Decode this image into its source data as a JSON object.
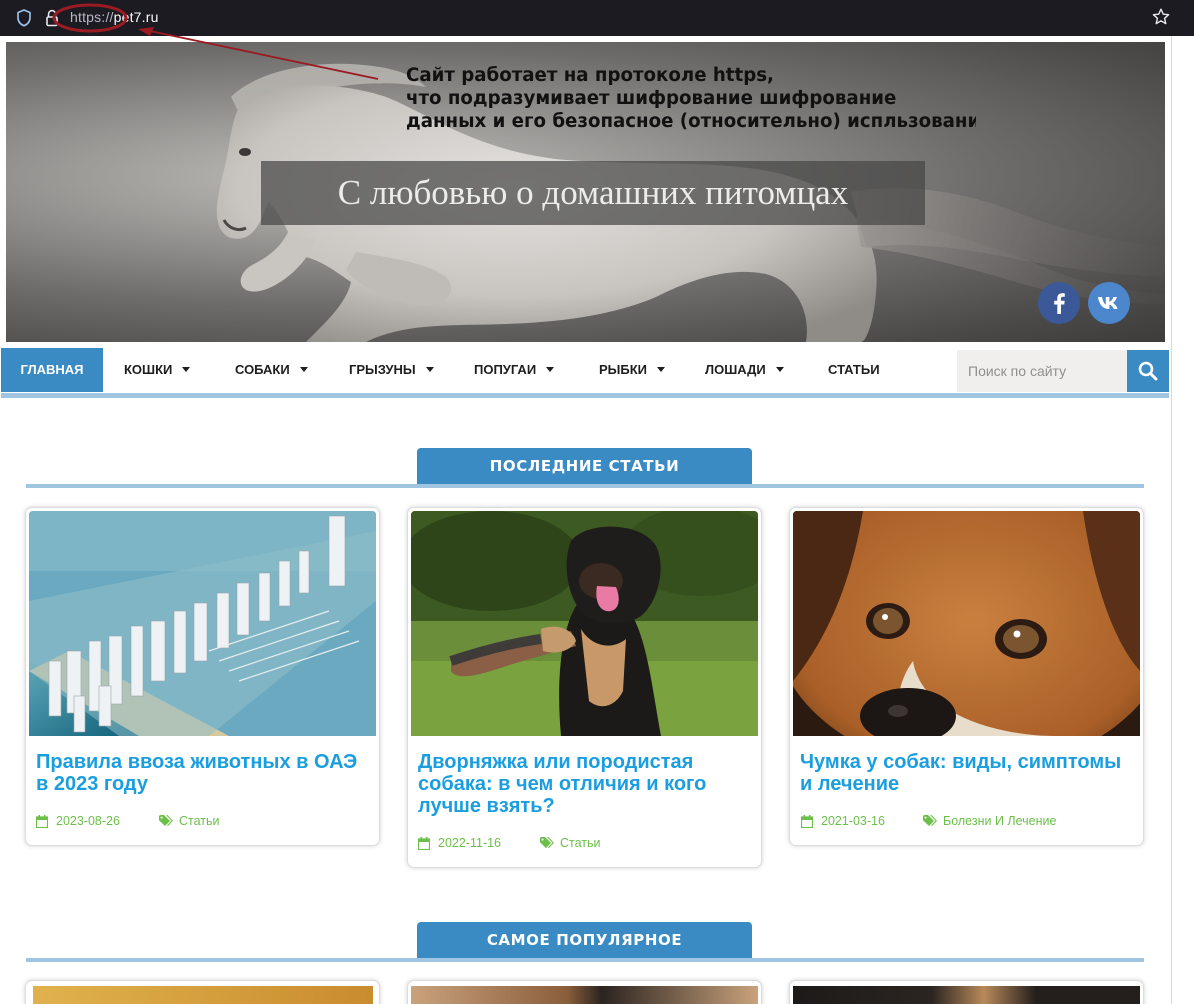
{
  "browser": {
    "url_protocol": "https://",
    "url_host": "pet7.ru"
  },
  "annotation": {
    "lines": [
      "Сайт работает на протоколе https,",
      "что подразумивает шифрование шифрование",
      "данных и его безопасное (относительно) испльзовани"
    ],
    "color": "#9b1b22"
  },
  "hero": {
    "title": "С любовью о домашних питомцах"
  },
  "social": {
    "fb_label": "f",
    "vk_label": "vk"
  },
  "nav": {
    "items": [
      {
        "label": "ГЛАВНАЯ",
        "active": true
      },
      {
        "label": "КОШКИ",
        "dropdown": true
      },
      {
        "label": "СОБАКИ",
        "dropdown": true
      },
      {
        "label": "ГРЫЗУНЫ",
        "dropdown": true
      },
      {
        "label": "ПОПУГАИ",
        "dropdown": true
      },
      {
        "label": "РЫБКИ",
        "dropdown": true
      },
      {
        "label": "ЛОШАДИ",
        "dropdown": true
      },
      {
        "label": "СТАТЬИ",
        "dropdown": false
      }
    ],
    "search_placeholder": "Поиск по сайту",
    "accent": "#3a8ac4"
  },
  "latest": {
    "heading": "ПОСЛЕДНИЕ СТАТЬИ",
    "cards": [
      {
        "title": "Правила ввоза животных в ОАЭ в 2023 году",
        "date": "2023-08-26",
        "category": "Статьи",
        "image": "dubai-marina-aerial"
      },
      {
        "title": "Дворняжка или породистая собака: в чем отличия и кого лучше взять?",
        "date": "2022-11-16",
        "category": "Статьи",
        "image": "black-dog-giving-paw"
      },
      {
        "title": "Чумка у собак: виды, симптомы и лечение",
        "date": "2021-03-16",
        "category": "Болезни И Лечение",
        "image": "sad-beagle-closeup"
      }
    ]
  },
  "popular": {
    "heading": "САМОЕ ПОПУЛЯРНОЕ"
  },
  "colors": {
    "title_link": "#1b9ee0",
    "meta": "#6cc04a",
    "section_line": "#9fc5e0"
  }
}
